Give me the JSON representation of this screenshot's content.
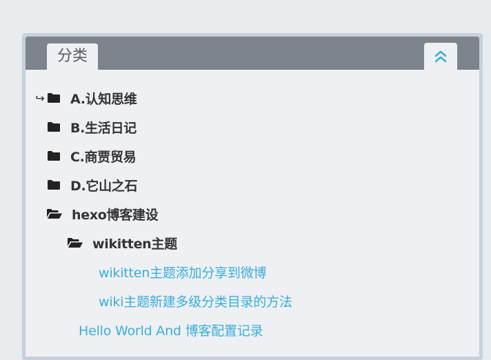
{
  "widget": {
    "tab_label": "分类",
    "collapse_icon": "double-chevron-up-icon",
    "accent_color": "#3aaed8",
    "header_color": "#7e848c"
  },
  "tree": {
    "current_marker_icon": "return-arrow-icon",
    "folders": [
      {
        "label": "A.认知思维",
        "icon": "folder-closed-icon"
      },
      {
        "label": "B.生活日记",
        "icon": "folder-closed-icon"
      },
      {
        "label": "C.商贾贸易",
        "icon": "folder-closed-icon"
      },
      {
        "label": "D.它山之石",
        "icon": "folder-closed-icon"
      },
      {
        "label": "hexo博客建设",
        "icon": "folder-open-icon"
      }
    ],
    "subfolder": {
      "label": "wikitten主题",
      "icon": "folder-open-icon"
    },
    "sub_links": [
      "wikitten主题添加分享到微博",
      "wiki主题新建多级分类目录的方法"
    ],
    "link": "Hello World And 博客配置记录"
  }
}
